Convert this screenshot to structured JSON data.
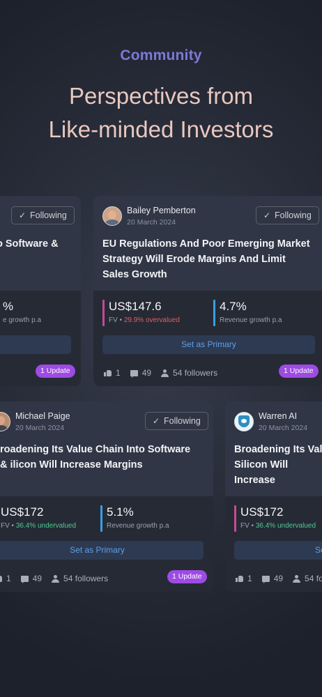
{
  "section_label": "Community",
  "headline_line1": "Perspectives from",
  "headline_line2": "Like-minded Investors",
  "colors": {
    "accent_purple": "#7d79d8",
    "headline": "#e9c8bf",
    "fair_value_bar": "#c74a93",
    "revenue_bar": "#3a9ee2",
    "overvalued": "#e85c5c",
    "undervalued": "#4fc98f",
    "update_badge": "#9d4be3"
  },
  "cards": [
    {
      "author": "",
      "date": "",
      "follow_label": "Following",
      "title": "o Software &",
      "fair_value": "",
      "fv_label": "",
      "valuation": "",
      "revenue_growth": "%",
      "revenue_label": "e growth p.a",
      "primary_label": "",
      "likes": "",
      "comments": "",
      "followers": "",
      "update_label": "1 Update"
    },
    {
      "author": "Bailey Pemberton",
      "date": "20 March 2024",
      "follow_label": "Following",
      "title": "EU Regulations And Poor Emerging Market Strategy Will Erode Margins And Limit Sales Growth",
      "fair_value": "US$147.6",
      "fv_label": "FV •",
      "valuation": "29.9% overvalued",
      "revenue_growth": "4.7%",
      "revenue_label": "Revenue growth p.a",
      "primary_label": "Set as Primary",
      "likes": "1",
      "comments": "49",
      "followers": "54 followers",
      "update_label": "1 Update"
    },
    {
      "author": "Michael Paige",
      "date": "20 March 2024",
      "follow_label": "Following",
      "title": "roadening Its Value Chain Into Software & ilicon Will Increase Margins",
      "fair_value": "US$172",
      "fv_label": "FV •",
      "valuation": "36.4% undervalued",
      "revenue_growth": "5.1%",
      "revenue_label": "Revenue growth p.a",
      "primary_label": "Set as Primary",
      "likes": "1",
      "comments": "49",
      "followers": "54 followers",
      "update_label": "1 Update"
    },
    {
      "author": "Warren AI",
      "date": "20 March 2024",
      "follow_label": "",
      "title": "Broadening Its Valu Silicon Will Increase",
      "fair_value": "US$172",
      "fv_label": "FV •",
      "valuation": "36.4% undervalued",
      "revenue_growth": "",
      "revenue_label": "",
      "primary_label": "Se",
      "likes": "1",
      "comments": "49",
      "followers": "54 foll",
      "update_label": ""
    }
  ]
}
